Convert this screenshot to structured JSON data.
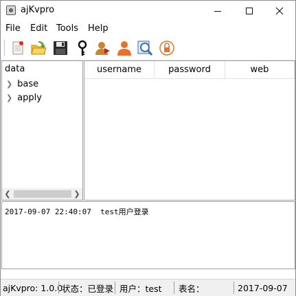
{
  "window": {
    "title": "ajKvpro",
    "minimize_glyph": "—",
    "maximize_glyph": "☐",
    "close_glyph": "✕"
  },
  "menu": {
    "items": [
      "File",
      "Edit",
      "Tools",
      "Help"
    ]
  },
  "toolbar": {
    "icons": [
      "new-document-icon",
      "open-folder-icon",
      "save-icon",
      "key-icon",
      "user-edit-icon",
      "user-icon",
      "search-icon",
      "lock-icon"
    ]
  },
  "tree": {
    "header": "data",
    "nodes": [
      {
        "label": "base"
      },
      {
        "label": "apply"
      }
    ]
  },
  "table": {
    "columns": [
      "username",
      "password",
      "web"
    ]
  },
  "log": {
    "lines": [
      "2017-09-07 22:40:07  test用户登录"
    ]
  },
  "status": {
    "version": "ajKvpro: 1.0.0",
    "login_state": "状态：已登录",
    "user": "用户：test",
    "table_name": "表名：",
    "date": "2017-09-07"
  },
  "colors": {
    "accent_orange": "#e8722a",
    "folder_green": "#5aa02c",
    "search_blue": "#3a6fb0"
  }
}
